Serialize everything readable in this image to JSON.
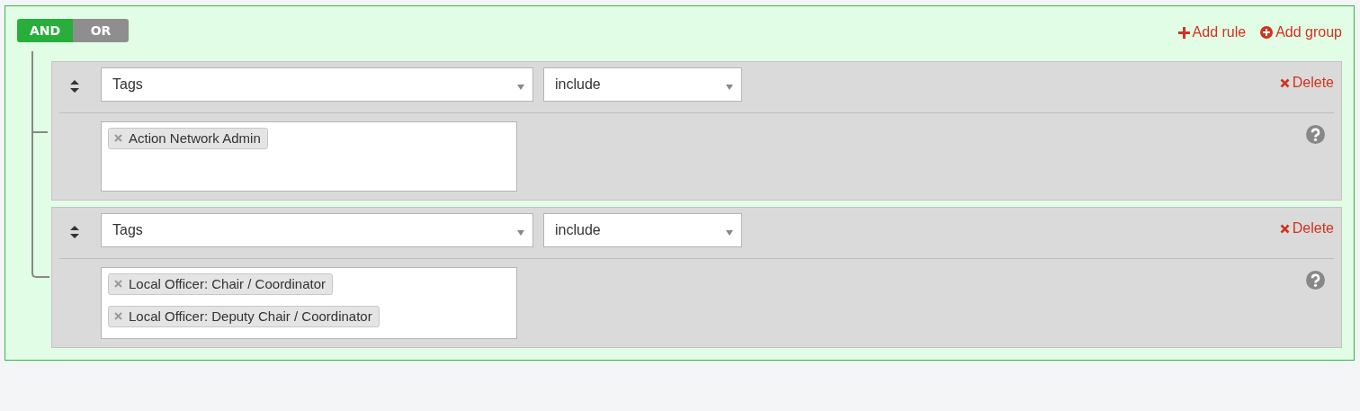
{
  "conjunctions": [
    {
      "label": "AND",
      "selected": true
    },
    {
      "label": "OR",
      "selected": false
    }
  ],
  "actions": [
    {
      "kind": "add-rule",
      "label": "Add rule"
    },
    {
      "kind": "add-group",
      "label": "Add group"
    }
  ],
  "rules": [
    {
      "field": "Tags",
      "operator": "include",
      "delete_label": "Delete",
      "tags": [
        "Action Network Admin"
      ]
    },
    {
      "field": "Tags",
      "operator": "include",
      "delete_label": "Delete",
      "tags": [
        "Local Officer: Chair / Coordinator",
        "Local Officer: Deputy Chair / Coordinator"
      ]
    }
  ]
}
